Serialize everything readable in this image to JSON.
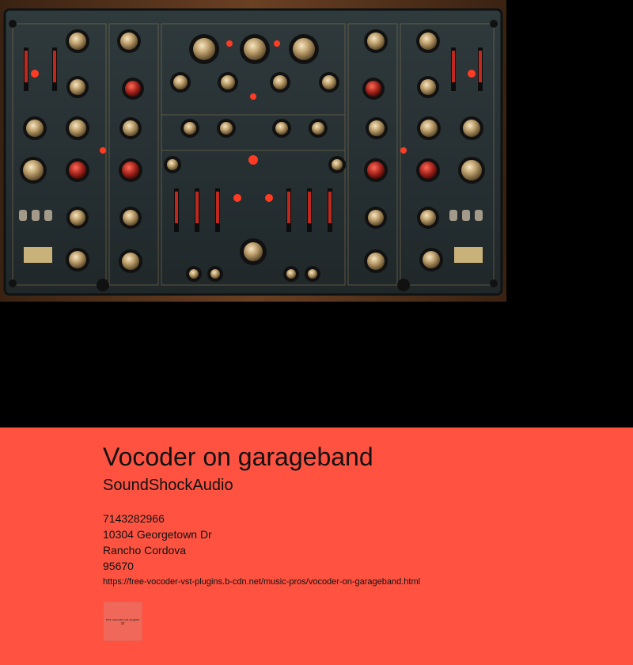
{
  "hero": {
    "image_alt": "Vintage analog vocoder synthesizer panel with knobs and sliders"
  },
  "listing": {
    "title": "Vocoder on garageband",
    "business_name": "SoundShockAudio",
    "phone": "7143282966",
    "street": "10304 Georgetown Dr",
    "city": "Rancho Cordova",
    "zip": "95670",
    "url": "https://free-vocoder-vst-plugins.b-cdn.net/music-pros/vocoder-on-garageband.html"
  },
  "thumbnail": {
    "caption": "free vocoder vst plugins",
    "mark": "sf"
  },
  "colors": {
    "page_background": "#000000",
    "panel_background": "#ff5240"
  }
}
